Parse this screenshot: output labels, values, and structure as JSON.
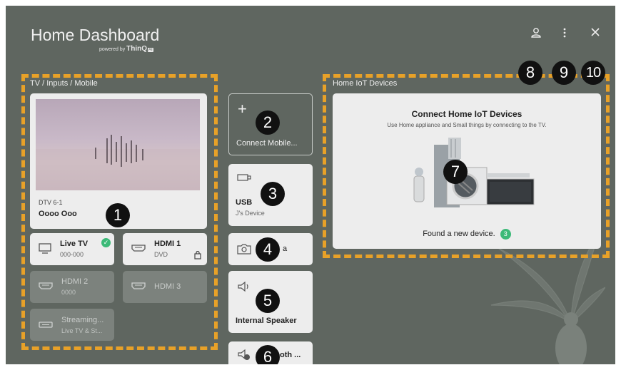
{
  "header": {
    "title": "Home Dashboard",
    "powered_prefix": "powered by",
    "powered_brand": "ThinQ",
    "powered_ai": "AI",
    "account_icon": "person-icon",
    "menu_icon": "more-vert-icon",
    "close_icon": "close-icon"
  },
  "markers": {
    "m1": "1",
    "m2": "2",
    "m3": "3",
    "m4": "4",
    "m5": "5",
    "m6": "6",
    "m7": "7",
    "m8": "8",
    "m9": "9",
    "m10": "10"
  },
  "inputs": {
    "section_label": "TV / Inputs / Mobile",
    "current": {
      "channel": "DTV 6-1",
      "program": "Oooo Ooo"
    },
    "items": [
      {
        "label": "Live TV",
        "sub": "000-000",
        "icon": "tv-icon",
        "active": true
      },
      {
        "label": "HDMI 1",
        "sub": "DVD",
        "icon": "hdmi-icon"
      },
      {
        "label": "HDMI 2",
        "sub": "0000",
        "icon": "hdmi-icon"
      },
      {
        "label": "HDMI 3",
        "sub": "",
        "icon": "hdmi-icon"
      },
      {
        "label": "Streaming...",
        "sub": "Live TV & St...",
        "icon": "streaming-icon"
      }
    ]
  },
  "middle": {
    "connect_mobile": {
      "icon": "plus-icon",
      "label": "Connect Mobile..."
    },
    "usb": {
      "label": "USB",
      "sub": "J's Device",
      "icon": "usb-icon"
    },
    "camera": {
      "label": "a",
      "icon": "camera-icon"
    },
    "speaker": {
      "label": "Internal Speaker",
      "icon": "speaker-icon"
    },
    "bluetooth": {
      "label": "oth ...",
      "icon": "bluetooth-speaker-icon"
    }
  },
  "iot": {
    "section_label": "Home IoT Devices",
    "title": "Connect Home IoT Devices",
    "subtitle": "Use Home appliance and Small things by connecting to the TV.",
    "found_text": "Found a new device.",
    "found_count": "3"
  },
  "colors": {
    "background": "#5f6660",
    "accent": "#e8a128",
    "card": "#ededed",
    "success": "#3cba78"
  }
}
